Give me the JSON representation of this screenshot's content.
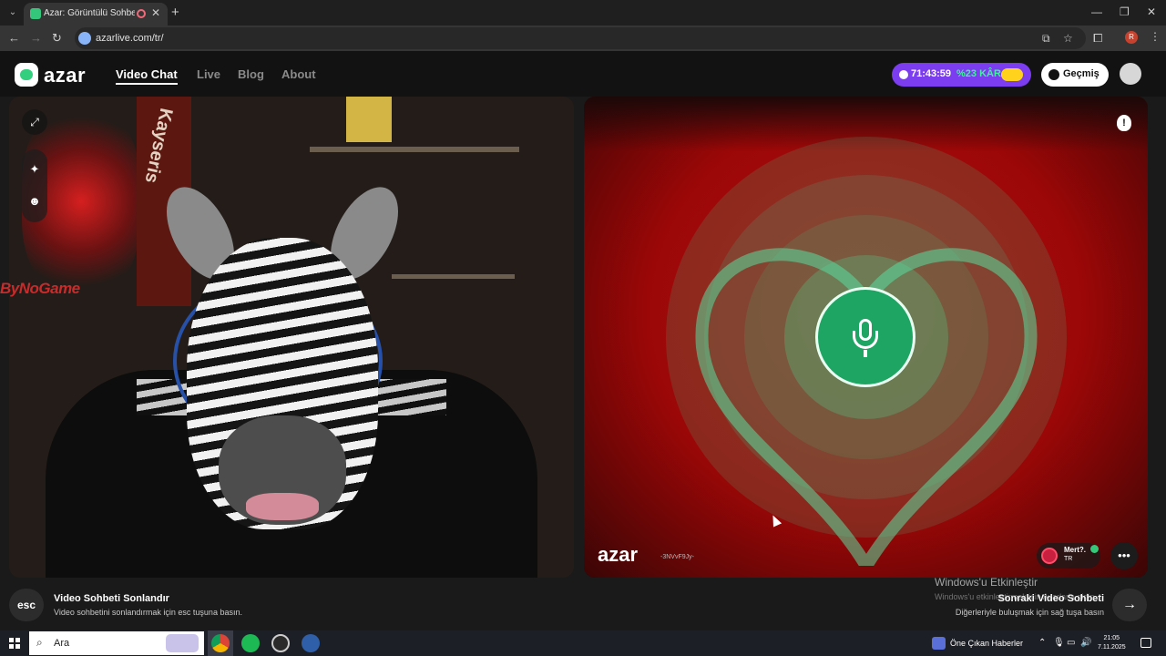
{
  "browser": {
    "tab_title": "Azar: Görüntülü Sohbet, Ye",
    "url": "azarlive.com/tr/"
  },
  "header": {
    "logo": "azar",
    "nav": [
      "Video Chat",
      "Live",
      "Blog",
      "About"
    ],
    "promo_timer": "71:43:59",
    "promo_deal": "%23 KÂR",
    "history_label": "Geçmiş"
  },
  "left_video": {
    "banner_text": "Kayseris",
    "watermark": "ByNoGame"
  },
  "right_video": {
    "logo": "azar",
    "session_id": "-3NVvF9Jy-",
    "user_name": "Mert?.",
    "user_country": "TR",
    "report_glyph": "!"
  },
  "bottom": {
    "esc_key": "esc",
    "end_title": "Video Sohbeti Sonlandır",
    "end_desc": "Video sohbetini sonlandırmak için esc tuşuna basın.",
    "next_title": "Sonraki Video Sohbeti",
    "next_desc": "Diğerleriyle buluşmak için sağ tuşa basın"
  },
  "windows": {
    "activation_title": "Windows'u Etkinleştir",
    "activation_desc": "Windows'u etkinleştirmek için Ayarlar'a gidin.",
    "search_placeholder": "Ara",
    "news": "Öne Çıkan Haberler",
    "time": "21:05",
    "date": "7.11.2025"
  },
  "colors": {
    "accent": "#34c77b",
    "promo": "#7c3df0",
    "remote_bg": "#9b0707"
  }
}
